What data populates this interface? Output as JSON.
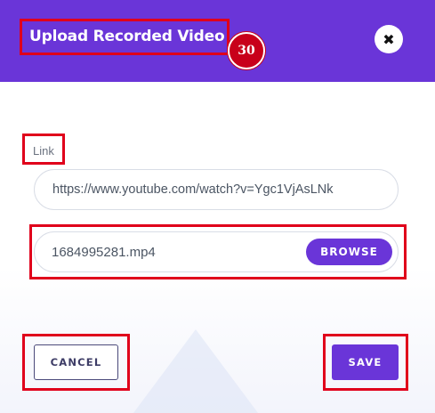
{
  "dialog": {
    "title": "Upload Recorded Video",
    "badge": "30",
    "close_icon": "close-icon"
  },
  "form": {
    "link_label": "Link",
    "link_value": "https://www.youtube.com/watch?v=Ygc1VjAsLNk",
    "file_name": "1684995281.mp4",
    "browse_label": "BROWSE"
  },
  "actions": {
    "cancel_label": "CANCEL",
    "save_label": "SAVE"
  },
  "colors": {
    "accent": "#6a35d8",
    "highlight": "#e0001b",
    "badge": "#c8001a"
  }
}
